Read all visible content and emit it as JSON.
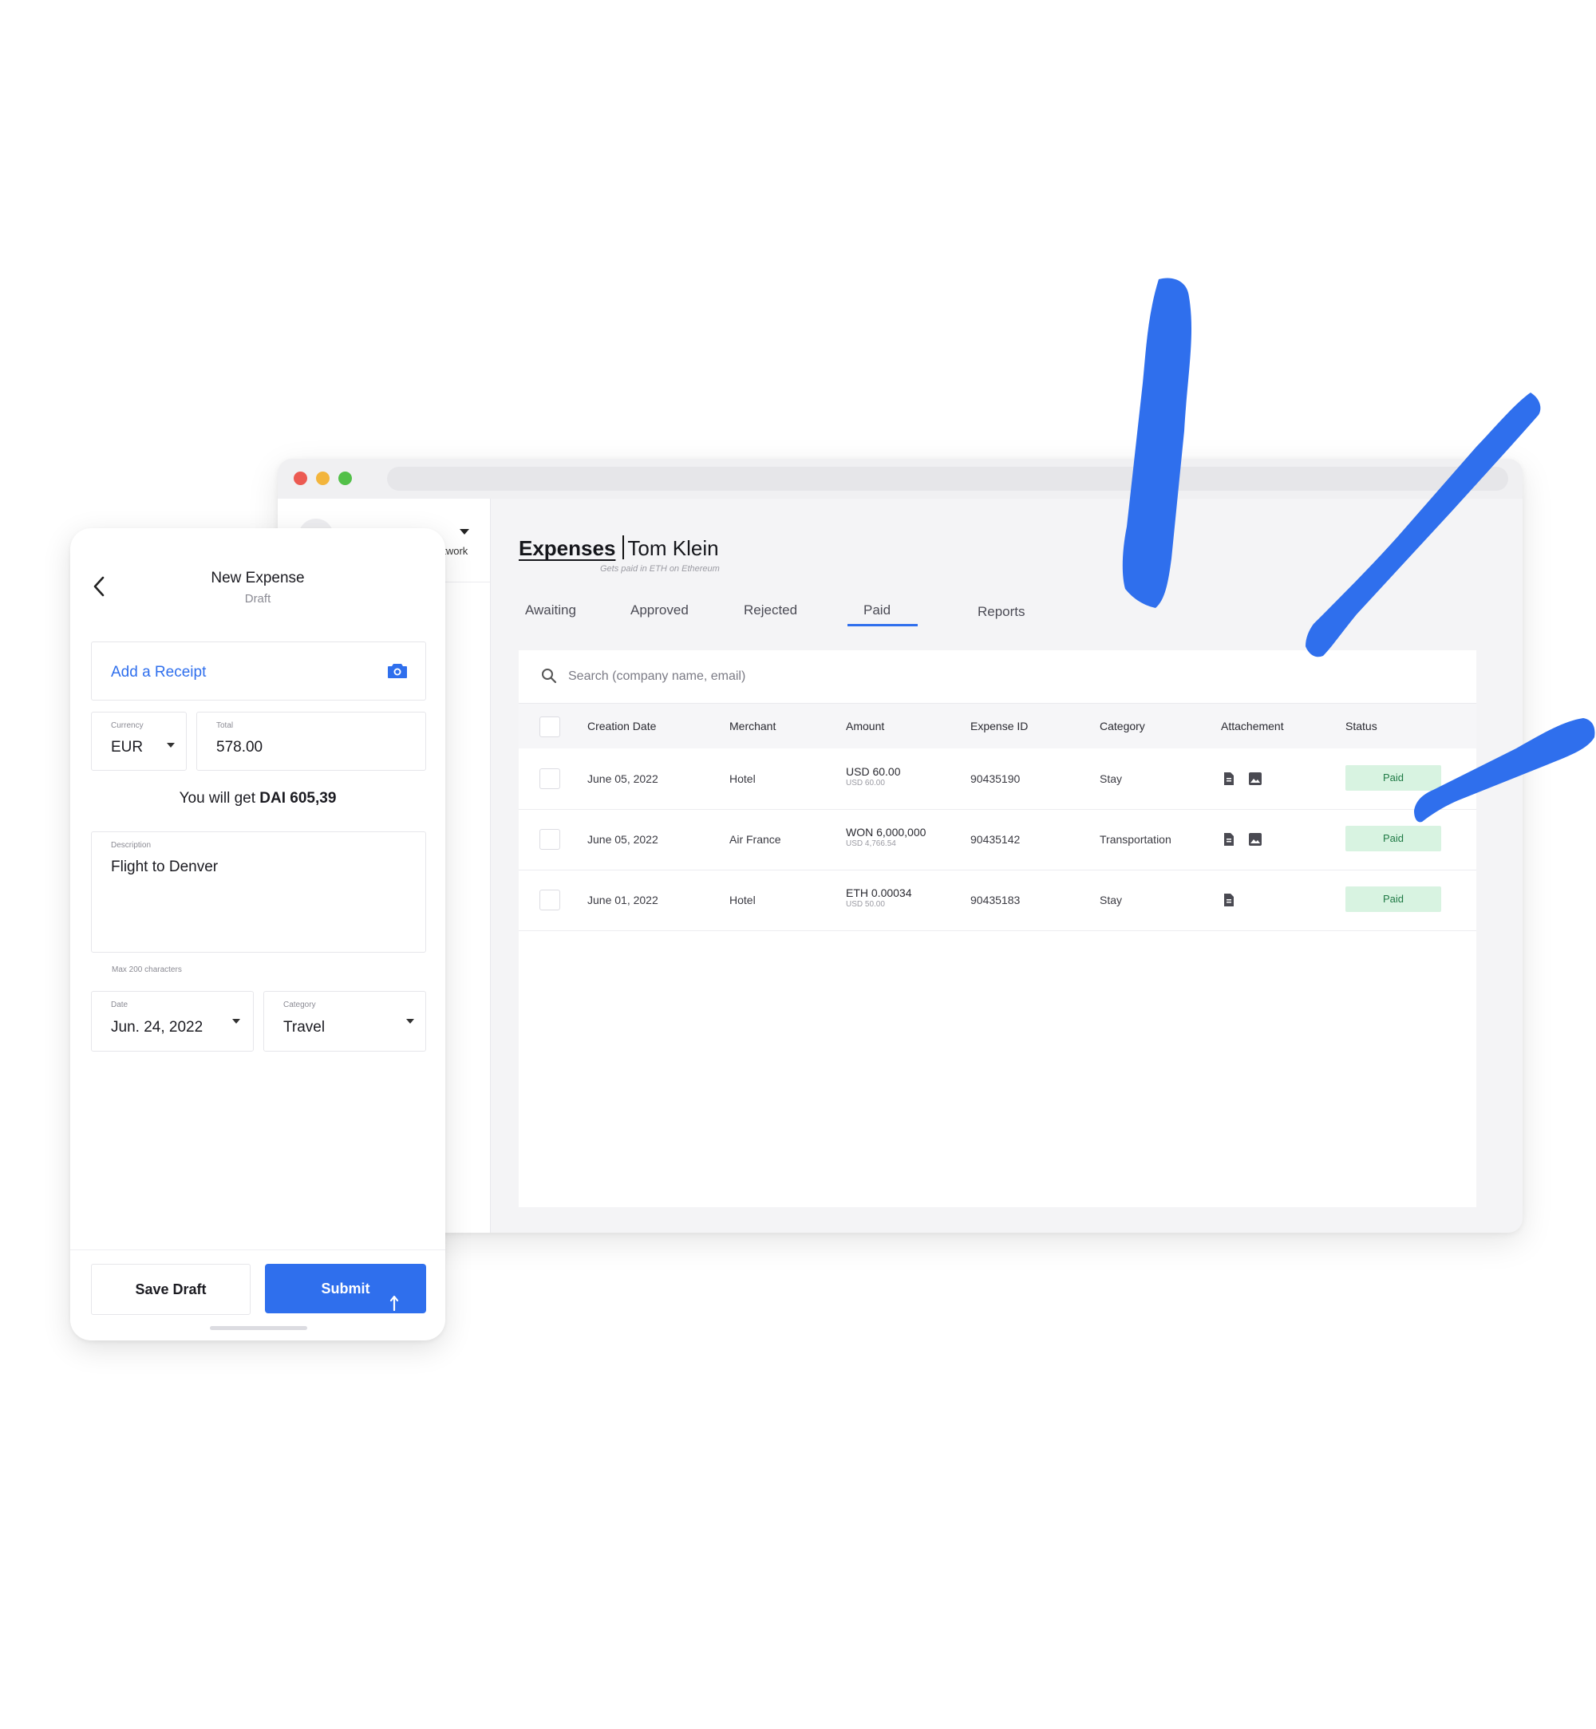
{
  "colors": {
    "accent": "#2f6fed",
    "paid_badge_bg": "#d8f3e1",
    "paid_badge_text": "#1f7a45",
    "brush_stroke": "#2f6fed"
  },
  "desktop": {
    "sidebar": {
      "network_label": "etwork"
    },
    "header": {
      "title": "Expenses",
      "user": "Tom Klein",
      "subtitle": "Gets paid in ETH on Ethereum"
    },
    "tabs": [
      {
        "label": "Awaiting",
        "active": false
      },
      {
        "label": "Approved",
        "active": false
      },
      {
        "label": "Rejected",
        "active": false
      },
      {
        "label": "Paid",
        "active": true
      },
      {
        "label": "Reports",
        "active": false
      }
    ],
    "search": {
      "placeholder": "Search (company name, email)",
      "icon": "search-icon"
    },
    "table": {
      "columns": [
        "Creation Date",
        "Merchant",
        "Amount",
        "Expense ID",
        "Category",
        "Attachement",
        "Status"
      ],
      "rows": [
        {
          "date": "June 05, 2022",
          "merchant": "Hotel",
          "amount": "USD 60.00",
          "amount_sub": "USD 60.00",
          "expense_id": "90435190",
          "category": "Stay",
          "attachments": [
            "document-icon",
            "image-icon"
          ],
          "status": "Paid"
        },
        {
          "date": "June 05, 2022",
          "merchant": "Air France",
          "amount": "WON 6,000,000",
          "amount_sub": "USD 4,766.54",
          "expense_id": "90435142",
          "category": "Transportation",
          "attachments": [
            "document-icon",
            "image-icon"
          ],
          "status": "Paid"
        },
        {
          "date": "June 01, 2022",
          "merchant": "Hotel",
          "amount": "ETH 0.00034",
          "amount_sub": "USD 50.00",
          "expense_id": "90435183",
          "category": "Stay",
          "attachments": [
            "document-icon"
          ],
          "status": "Paid"
        }
      ]
    }
  },
  "mobile": {
    "title": "New Expense",
    "subtitle": "Draft",
    "receipt": {
      "label": "Add a Receipt",
      "icon": "camera-icon"
    },
    "currency": {
      "label": "Currency",
      "value": "EUR"
    },
    "total": {
      "label": "Total",
      "value": "578.00"
    },
    "conversion": {
      "prefix": "You will get ",
      "amount": "DAI 605,39"
    },
    "description": {
      "label": "Description",
      "value": "Flight to Denver",
      "note": "Max 200 characters"
    },
    "date": {
      "label": "Date",
      "value": "Jun. 24, 2022"
    },
    "category": {
      "label": "Category",
      "value": "Travel"
    },
    "buttons": {
      "save": "Save Draft",
      "submit": "Submit"
    }
  }
}
